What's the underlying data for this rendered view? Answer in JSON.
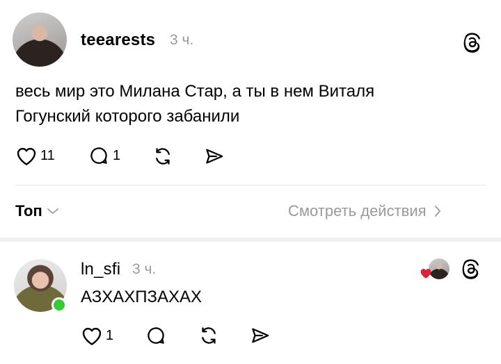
{
  "post": {
    "username": "teearests",
    "time": "3 ч.",
    "text": "весь мир это Милана Стар, а ты в нем Виталя Гогунский которого забанили",
    "likes": "11",
    "replies": "1"
  },
  "sort": {
    "label": "Топ",
    "activity_label": "Смотреть действия"
  },
  "reply": {
    "username": "ln_sfi",
    "time": "3 ч.",
    "text": "АЗХАХПЗАХАХ",
    "likes": "1",
    "liked_by_author_color": "#e0203a"
  },
  "colors": {
    "online": "#33cc33",
    "muted": "#9a9a9a"
  }
}
